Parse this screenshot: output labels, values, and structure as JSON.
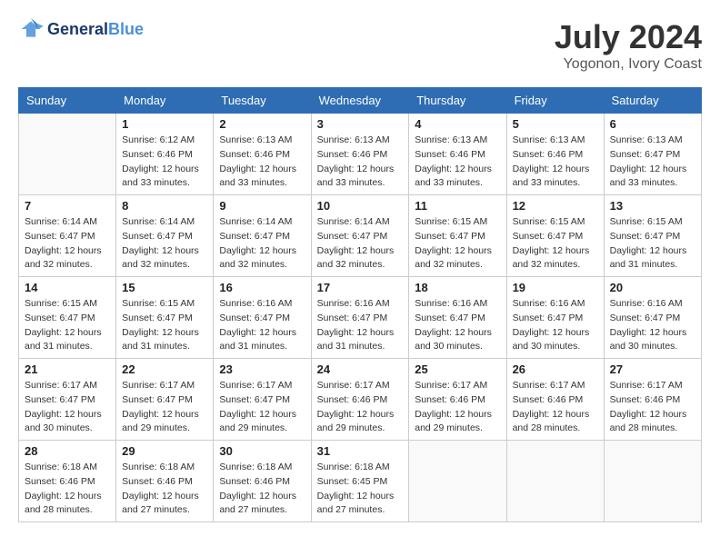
{
  "header": {
    "logo_text_general": "General",
    "logo_text_blue": "Blue",
    "month_year": "July 2024",
    "location": "Yogonon, Ivory Coast"
  },
  "calendar": {
    "days_of_week": [
      "Sunday",
      "Monday",
      "Tuesday",
      "Wednesday",
      "Thursday",
      "Friday",
      "Saturday"
    ],
    "weeks": [
      [
        {
          "day": "",
          "sunrise": "",
          "sunset": "",
          "daylight": ""
        },
        {
          "day": "1",
          "sunrise": "Sunrise: 6:12 AM",
          "sunset": "Sunset: 6:46 PM",
          "daylight": "Daylight: 12 hours and 33 minutes."
        },
        {
          "day": "2",
          "sunrise": "Sunrise: 6:13 AM",
          "sunset": "Sunset: 6:46 PM",
          "daylight": "Daylight: 12 hours and 33 minutes."
        },
        {
          "day": "3",
          "sunrise": "Sunrise: 6:13 AM",
          "sunset": "Sunset: 6:46 PM",
          "daylight": "Daylight: 12 hours and 33 minutes."
        },
        {
          "day": "4",
          "sunrise": "Sunrise: 6:13 AM",
          "sunset": "Sunset: 6:46 PM",
          "daylight": "Daylight: 12 hours and 33 minutes."
        },
        {
          "day": "5",
          "sunrise": "Sunrise: 6:13 AM",
          "sunset": "Sunset: 6:46 PM",
          "daylight": "Daylight: 12 hours and 33 minutes."
        },
        {
          "day": "6",
          "sunrise": "Sunrise: 6:13 AM",
          "sunset": "Sunset: 6:47 PM",
          "daylight": "Daylight: 12 hours and 33 minutes."
        }
      ],
      [
        {
          "day": "7",
          "sunrise": "Sunrise: 6:14 AM",
          "sunset": "Sunset: 6:47 PM",
          "daylight": "Daylight: 12 hours and 32 minutes."
        },
        {
          "day": "8",
          "sunrise": "Sunrise: 6:14 AM",
          "sunset": "Sunset: 6:47 PM",
          "daylight": "Daylight: 12 hours and 32 minutes."
        },
        {
          "day": "9",
          "sunrise": "Sunrise: 6:14 AM",
          "sunset": "Sunset: 6:47 PM",
          "daylight": "Daylight: 12 hours and 32 minutes."
        },
        {
          "day": "10",
          "sunrise": "Sunrise: 6:14 AM",
          "sunset": "Sunset: 6:47 PM",
          "daylight": "Daylight: 12 hours and 32 minutes."
        },
        {
          "day": "11",
          "sunrise": "Sunrise: 6:15 AM",
          "sunset": "Sunset: 6:47 PM",
          "daylight": "Daylight: 12 hours and 32 minutes."
        },
        {
          "day": "12",
          "sunrise": "Sunrise: 6:15 AM",
          "sunset": "Sunset: 6:47 PM",
          "daylight": "Daylight: 12 hours and 32 minutes."
        },
        {
          "day": "13",
          "sunrise": "Sunrise: 6:15 AM",
          "sunset": "Sunset: 6:47 PM",
          "daylight": "Daylight: 12 hours and 31 minutes."
        }
      ],
      [
        {
          "day": "14",
          "sunrise": "Sunrise: 6:15 AM",
          "sunset": "Sunset: 6:47 PM",
          "daylight": "Daylight: 12 hours and 31 minutes."
        },
        {
          "day": "15",
          "sunrise": "Sunrise: 6:15 AM",
          "sunset": "Sunset: 6:47 PM",
          "daylight": "Daylight: 12 hours and 31 minutes."
        },
        {
          "day": "16",
          "sunrise": "Sunrise: 6:16 AM",
          "sunset": "Sunset: 6:47 PM",
          "daylight": "Daylight: 12 hours and 31 minutes."
        },
        {
          "day": "17",
          "sunrise": "Sunrise: 6:16 AM",
          "sunset": "Sunset: 6:47 PM",
          "daylight": "Daylight: 12 hours and 31 minutes."
        },
        {
          "day": "18",
          "sunrise": "Sunrise: 6:16 AM",
          "sunset": "Sunset: 6:47 PM",
          "daylight": "Daylight: 12 hours and 30 minutes."
        },
        {
          "day": "19",
          "sunrise": "Sunrise: 6:16 AM",
          "sunset": "Sunset: 6:47 PM",
          "daylight": "Daylight: 12 hours and 30 minutes."
        },
        {
          "day": "20",
          "sunrise": "Sunrise: 6:16 AM",
          "sunset": "Sunset: 6:47 PM",
          "daylight": "Daylight: 12 hours and 30 minutes."
        }
      ],
      [
        {
          "day": "21",
          "sunrise": "Sunrise: 6:17 AM",
          "sunset": "Sunset: 6:47 PM",
          "daylight": "Daylight: 12 hours and 30 minutes."
        },
        {
          "day": "22",
          "sunrise": "Sunrise: 6:17 AM",
          "sunset": "Sunset: 6:47 PM",
          "daylight": "Daylight: 12 hours and 29 minutes."
        },
        {
          "day": "23",
          "sunrise": "Sunrise: 6:17 AM",
          "sunset": "Sunset: 6:47 PM",
          "daylight": "Daylight: 12 hours and 29 minutes."
        },
        {
          "day": "24",
          "sunrise": "Sunrise: 6:17 AM",
          "sunset": "Sunset: 6:46 PM",
          "daylight": "Daylight: 12 hours and 29 minutes."
        },
        {
          "day": "25",
          "sunrise": "Sunrise: 6:17 AM",
          "sunset": "Sunset: 6:46 PM",
          "daylight": "Daylight: 12 hours and 29 minutes."
        },
        {
          "day": "26",
          "sunrise": "Sunrise: 6:17 AM",
          "sunset": "Sunset: 6:46 PM",
          "daylight": "Daylight: 12 hours and 28 minutes."
        },
        {
          "day": "27",
          "sunrise": "Sunrise: 6:17 AM",
          "sunset": "Sunset: 6:46 PM",
          "daylight": "Daylight: 12 hours and 28 minutes."
        }
      ],
      [
        {
          "day": "28",
          "sunrise": "Sunrise: 6:18 AM",
          "sunset": "Sunset: 6:46 PM",
          "daylight": "Daylight: 12 hours and 28 minutes."
        },
        {
          "day": "29",
          "sunrise": "Sunrise: 6:18 AM",
          "sunset": "Sunset: 6:46 PM",
          "daylight": "Daylight: 12 hours and 27 minutes."
        },
        {
          "day": "30",
          "sunrise": "Sunrise: 6:18 AM",
          "sunset": "Sunset: 6:46 PM",
          "daylight": "Daylight: 12 hours and 27 minutes."
        },
        {
          "day": "31",
          "sunrise": "Sunrise: 6:18 AM",
          "sunset": "Sunset: 6:45 PM",
          "daylight": "Daylight: 12 hours and 27 minutes."
        },
        {
          "day": "",
          "sunrise": "",
          "sunset": "",
          "daylight": ""
        },
        {
          "day": "",
          "sunrise": "",
          "sunset": "",
          "daylight": ""
        },
        {
          "day": "",
          "sunrise": "",
          "sunset": "",
          "daylight": ""
        }
      ]
    ]
  }
}
